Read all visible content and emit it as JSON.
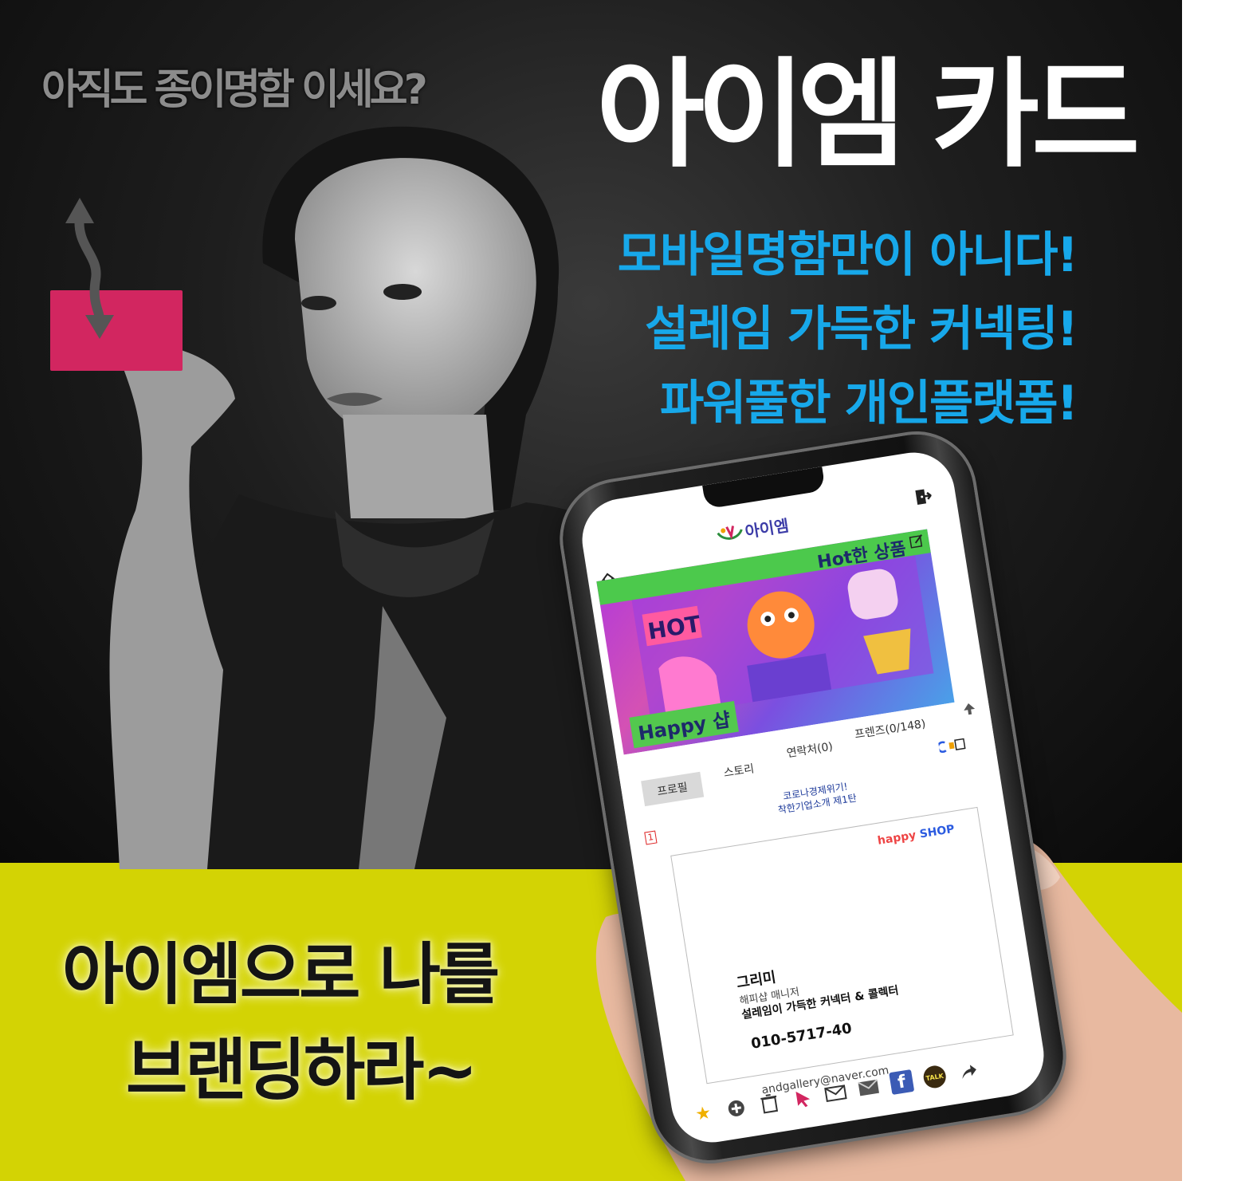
{
  "poster": {
    "subtitle": "아직도 종이명함 이세요?",
    "brand": "아이엠 카드",
    "taglines": [
      "모바일명함만이 아니다!",
      "설레임 가득한 커넥팅!",
      "파워풀한 개인플랫폼!"
    ],
    "slogan": [
      "아이엠으로 나를",
      "브랜딩하라~"
    ],
    "colors": {
      "accent_blue": "#17a8ea",
      "accent_yellow": "#d3d304",
      "card_pink": "#d22660"
    }
  },
  "app": {
    "logo": "아이엠",
    "banner": {
      "top_label": "Hot한 상품",
      "bottom_label": "Happy 샵"
    },
    "tabs": {
      "profile": "프로필",
      "story": "스토리",
      "contacts": "연락처(0)",
      "friends": "프렌즈(0/148)"
    },
    "notice": "코로나경제위기!\n착한기업소개 제1탄",
    "page_number": "1",
    "card": {
      "shop_logo_a": "happy",
      "shop_logo_b": "SHOP",
      "name": "그리미",
      "role": "해피샵 매니저",
      "motto": "설레임이 가득한 커넥터 & 콜렉터",
      "phone": "010-5717-40",
      "email": "andgallery@naver.com"
    },
    "toolbar_icons": [
      "star-icon",
      "add-icon",
      "trash-icon",
      "cursor-icon",
      "message-icon",
      "mail-icon",
      "facebook-icon",
      "kakaotalk-icon",
      "share-arrow-icon"
    ],
    "kakao_label": "TALK",
    "facebook_label": "f"
  }
}
